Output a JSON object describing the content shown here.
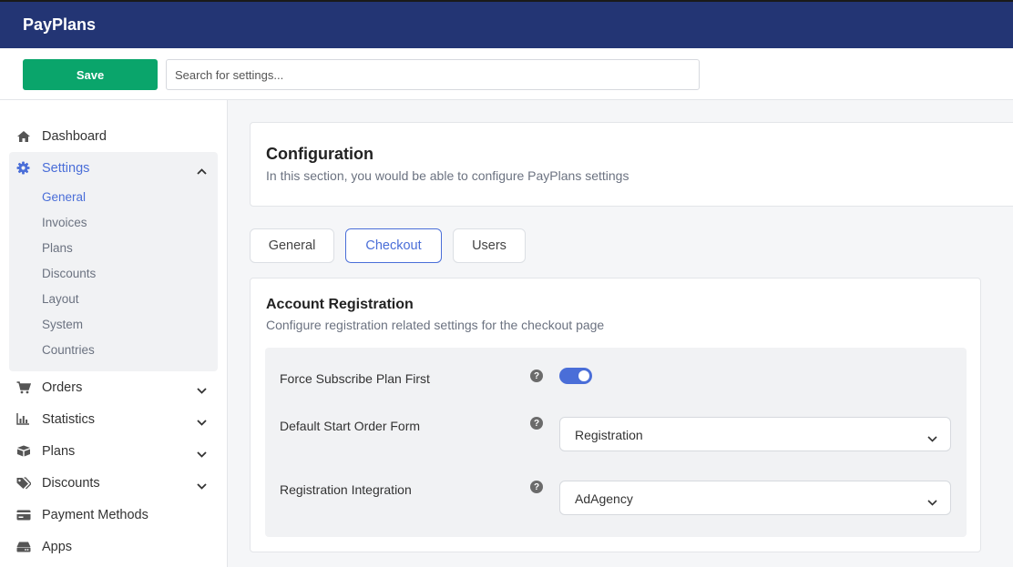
{
  "header": {
    "brand": "PayPlans"
  },
  "toolbar": {
    "save_label": "Save",
    "search_placeholder": "Search for settings..."
  },
  "sidebar": {
    "dashboard": "Dashboard",
    "settings": "Settings",
    "settings_sub": [
      "General",
      "Invoices",
      "Plans",
      "Discounts",
      "Layout",
      "System",
      "Countries"
    ],
    "orders": "Orders",
    "statistics": "Statistics",
    "plans": "Plans",
    "discounts": "Discounts",
    "payment_methods": "Payment Methods",
    "apps": "Apps"
  },
  "config": {
    "title": "Configuration",
    "description": "In this section, you would be able to configure PayPlans settings"
  },
  "tabs": [
    "General",
    "Checkout",
    "Users"
  ],
  "active_tab": "Checkout",
  "panel": {
    "title": "Account Registration",
    "description": "Configure registration related settings for the checkout page",
    "fields": {
      "force_subscribe": {
        "label": "Force Subscribe Plan First",
        "enabled": true
      },
      "default_form": {
        "label": "Default Start Order Form",
        "value": "Registration"
      },
      "integration": {
        "label": "Registration Integration",
        "value": "AdAgency"
      }
    }
  },
  "colors": {
    "header": "#233574",
    "save": "#0aa56b",
    "accent": "#4a6ed8"
  }
}
